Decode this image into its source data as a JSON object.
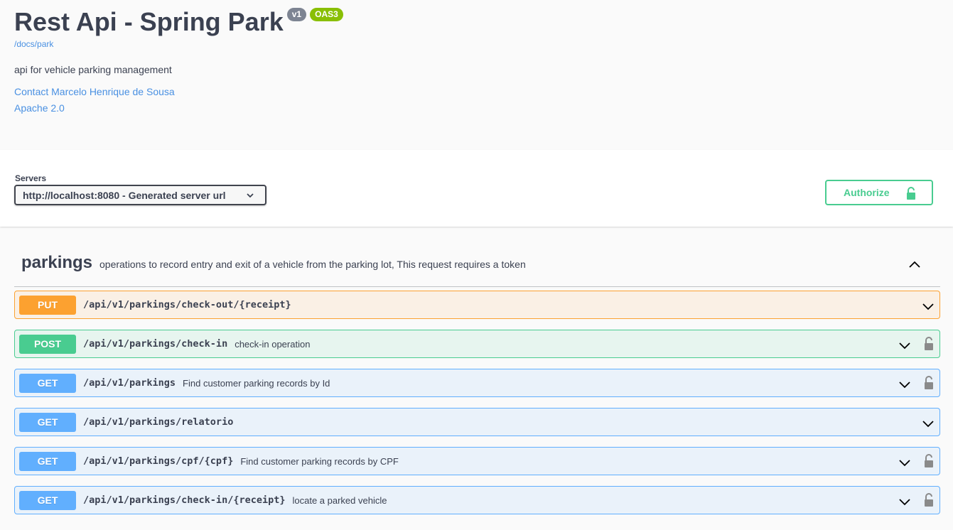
{
  "info": {
    "title": "Rest Api - Spring Park",
    "version_badge": "v1",
    "spec_badge": "OAS3",
    "docs_link": "/docs/park",
    "description": "api for vehicle parking management",
    "contact": "Contact Marcelo Henrique de Sousa",
    "license": "Apache 2.0"
  },
  "servers": {
    "label": "Servers",
    "selected": "http://localhost:8080 - Generated server url"
  },
  "authorize": {
    "label": "Authorize"
  },
  "tag": {
    "name": "parkings",
    "description": "operations to record entry and exit of a vehicle from the parking lot, This request requires a token"
  },
  "operations": [
    {
      "method": "PUT",
      "path": "/api/v1/parkings/check-out/{receipt}",
      "summary": "",
      "locked": false
    },
    {
      "method": "POST",
      "path": "/api/v1/parkings/check-in",
      "summary": "check-in operation",
      "locked": true
    },
    {
      "method": "GET",
      "path": "/api/v1/parkings",
      "summary": "Find customer parking records by Id",
      "locked": true
    },
    {
      "method": "GET",
      "path": "/api/v1/parkings/relatorio",
      "summary": "",
      "locked": false
    },
    {
      "method": "GET",
      "path": "/api/v1/parkings/cpf/{cpf}",
      "summary": "Find customer parking records by CPF",
      "locked": true
    },
    {
      "method": "GET",
      "path": "/api/v1/parkings/check-in/{receipt}",
      "summary": "locate a parked vehicle",
      "locked": true
    }
  ],
  "colors": {
    "put": "#fca130",
    "post": "#49cc90",
    "get": "#61affe",
    "link": "#4990e2",
    "text": "#3b4151"
  }
}
